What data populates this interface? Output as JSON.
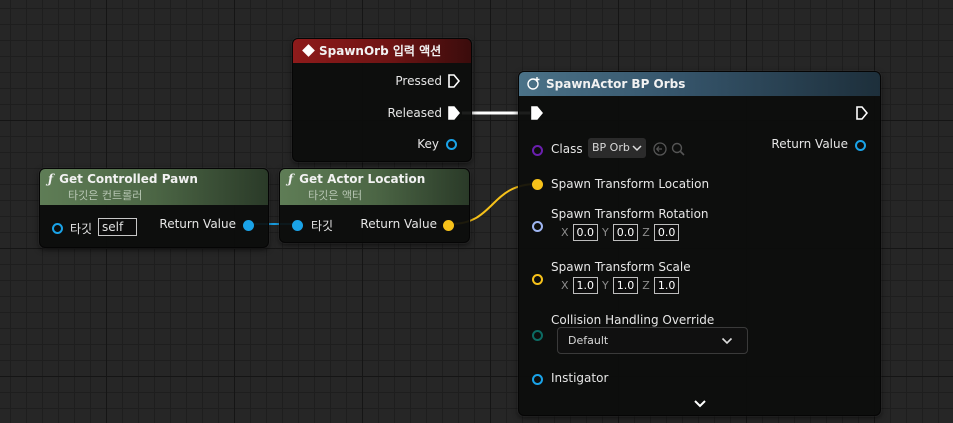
{
  "input_action_node": {
    "title": "SpawnOrb 입력 액션",
    "pins": {
      "pressed": "Pressed",
      "released": "Released",
      "key": "Key"
    },
    "header_color": "#8e1b1b"
  },
  "get_controlled_pawn_node": {
    "title": "Get Controlled Pawn",
    "subtitle": "타깃은 컨트롤러",
    "target_label": "타깃",
    "target_value": "self",
    "return_label": "Return Value",
    "header_color": "#5a7550"
  },
  "get_actor_location_node": {
    "title": "Get Actor Location",
    "subtitle": "타깃은 액터",
    "target_label": "타깃",
    "return_label": "Return Value",
    "header_color": "#5a7550"
  },
  "spawn_actor_node": {
    "title": "SpawnActor BP Orbs",
    "class_label": "Class",
    "class_value": "BP Orb",
    "return_label": "Return Value",
    "spawn_location_label": "Spawn Transform Location",
    "spawn_rotation_label": "Spawn Transform Rotation",
    "rotation": {
      "x_label": "X",
      "x": "0.0",
      "y_label": "Y",
      "y": "0.0",
      "z_label": "Z",
      "z": "0.0"
    },
    "spawn_scale_label": "Spawn Transform Scale",
    "scale": {
      "x_label": "X",
      "x": "1.0",
      "y_label": "Y",
      "y": "1.0",
      "z_label": "Z",
      "z": "1.0"
    },
    "collision_label": "Collision Handling Override",
    "collision_value": "Default",
    "instigator_label": "Instigator",
    "header_color": "#3b5a6c"
  },
  "colors": {
    "object_pin": "#1aa3e8",
    "vector_pin": "#f7c21a",
    "rotator_pin": "#9fb6f2",
    "class_pin": "#6a1fae",
    "enum_pin": "#0c6b63",
    "exec_wire": "#ffffff"
  }
}
